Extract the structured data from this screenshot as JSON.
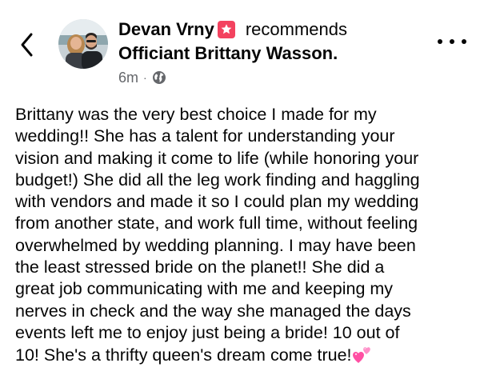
{
  "post": {
    "author_name": "Devan Vrny",
    "recommends_label": "recommends",
    "page_name": "Officiant Brittany Wasson.",
    "timestamp": "6m",
    "separator": "·",
    "audience_icon": "globe-icon",
    "lines": [
      "Brittany was the very best choice I made for my",
      "wedding!! She has a talent for understanding your",
      "vision and making it come to life (while honoring your",
      "budget!) She did all the leg work finding and haggling",
      "with vendors and made it so I could plan my wedding",
      "from another state, and work full time, without feeling",
      "overwhelmed by wedding planning. I may have been",
      "the least stressed bride on the planet!! She did a",
      "great job communicating with me and keeping my",
      "nerves in check and the way she managed the days",
      "events left me to enjoy just being a bride! 10 out of",
      "10! She's a thrifty queen's dream come true!"
    ],
    "end_emoji": "two-hearts-icon"
  },
  "icons": {
    "back": "chevron-left-icon",
    "more": "more-options-icon",
    "badge": "recommendation-star-icon"
  },
  "colors": {
    "text": "#050505",
    "meta": "#65676b",
    "badge": "#f3425f",
    "heart": "#ff69b4"
  }
}
